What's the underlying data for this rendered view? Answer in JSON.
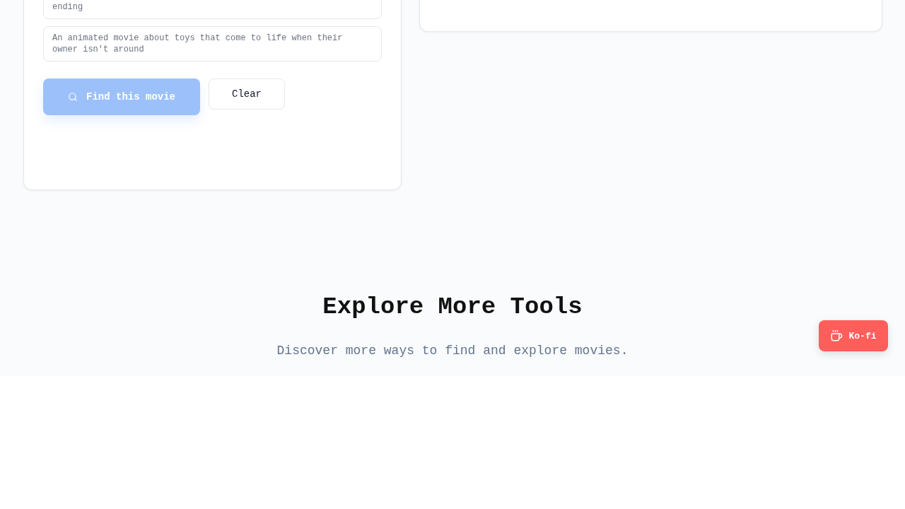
{
  "search_card": {
    "examples": [
      "ending",
      "An animated movie about toys that come to life when their owner isn't around"
    ],
    "find_button": {
      "label": "Find this movie",
      "disabled": true
    },
    "clear_button": {
      "label": "Clear"
    }
  },
  "explore_section": {
    "title": "Explore More Tools",
    "subtitle": "Discover more ways to find and explore movies."
  },
  "kofi_button": {
    "label": "Ko-fi"
  }
}
